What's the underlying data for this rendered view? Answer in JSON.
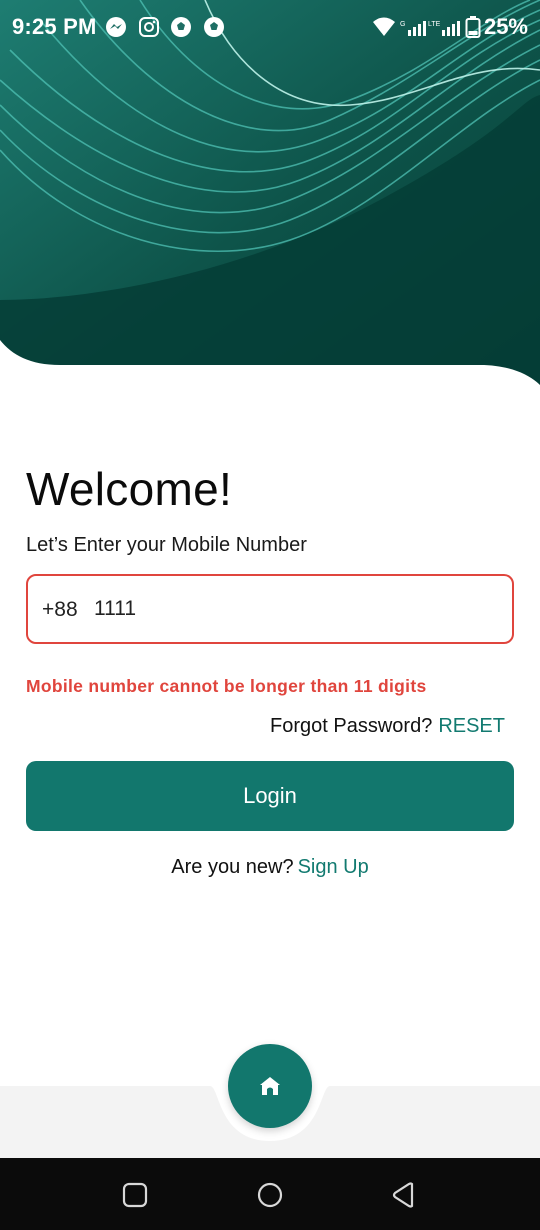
{
  "status_bar": {
    "time": "9:25 PM",
    "battery": "25%",
    "icons": [
      "messenger-icon",
      "instagram-icon",
      "football-icon",
      "football-icon",
      "wifi-icon",
      "signal-icon",
      "battery-icon"
    ]
  },
  "colors": {
    "primary": "#12776d",
    "header_dark": "#053d36",
    "error": "#e0453d"
  },
  "login": {
    "title": "Welcome!",
    "subtitle": "Let’s Enter your Mobile Number",
    "country_code": "+88",
    "phone_value": "1111",
    "error": "Mobile number cannot be longer than 11 digits",
    "forgot_label": "Forgot Password?",
    "reset_label": "RESET",
    "login_button": "Login",
    "new_label": "Are you new?",
    "signup_label": "Sign Up"
  },
  "bottom_nav": {
    "home_icon": "home-icon"
  },
  "system_nav": [
    "recents-icon",
    "home-circle-icon",
    "back-icon"
  ]
}
